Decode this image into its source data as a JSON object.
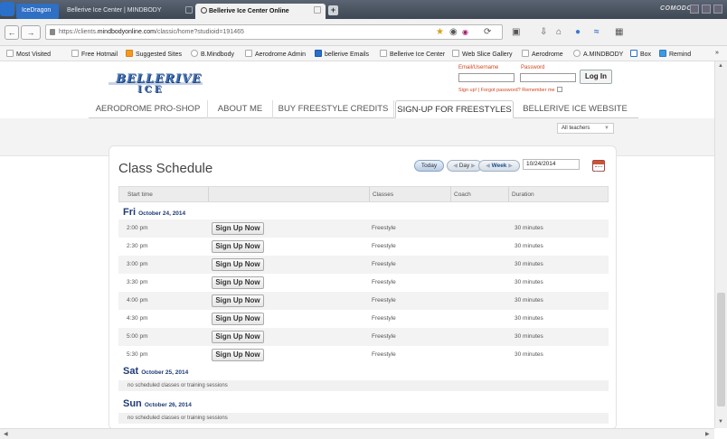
{
  "browser": {
    "brand": "COMODO",
    "tabs": [
      {
        "label": "IceDragon",
        "active": false
      },
      {
        "label": "Bellerive Ice Center | MINDBODY",
        "active": false
      },
      {
        "label": "Bellerive Ice Center Online",
        "active": true
      }
    ],
    "new_tab_label": "+",
    "url_prefix": "https://clients.",
    "url_domain": "mindbodyonline.com",
    "url_path": "/classic/home?studioid=191465"
  },
  "bookmarks": [
    "Most Visited",
    "Free Hotmail",
    "Suggested Sites",
    "B.Mindbody",
    "Aerodrome Admin",
    "bellerive Emails",
    "Bellerive Ice Center",
    "Web Slice Gallery",
    "Aerodrome",
    "A.MINDBODY",
    "Box",
    "Remind"
  ],
  "site": {
    "logo_line1": "BELLERIVE",
    "logo_line2": "ICE",
    "login": {
      "email_label": "Email/Username",
      "password_label": "Password",
      "button_label": "Log In",
      "signup_link": "Sign up!",
      "divider": "|",
      "forgot_link": "Forgot password?",
      "remember_label": "Remember me"
    },
    "menu": [
      "AERODROME PRO-SHOP",
      "ABOUT ME",
      "BUY FREESTYLE CREDITS",
      "SIGN-UP FOR FREESTYLES",
      "BELLERIVE ICE WEBSITE"
    ],
    "active_menu_index": 3,
    "teacher_filter": "All teachers"
  },
  "schedule": {
    "title": "Class Schedule",
    "today_label": "Today",
    "day_label": "Day",
    "week_label": "Week",
    "date_value": "10/24/2014",
    "columns": [
      "Start time",
      "",
      "Classes",
      "Coach",
      "Duration"
    ],
    "signup_label": "Sign Up Now",
    "days": [
      {
        "day": "Fri",
        "date": "October 24, 2014",
        "rows": [
          {
            "time": "2:00 pm",
            "class": "Freestyle",
            "coach": "",
            "duration": "30 minutes"
          },
          {
            "time": "2:30 pm",
            "class": "Freestyle",
            "coach": "",
            "duration": "30 minutes"
          },
          {
            "time": "3:00 pm",
            "class": "Freestyle",
            "coach": "",
            "duration": "30 minutes"
          },
          {
            "time": "3:30 pm",
            "class": "Freestyle",
            "coach": "",
            "duration": "30 minutes"
          },
          {
            "time": "4:00 pm",
            "class": "Freestyle",
            "coach": "",
            "duration": "30 minutes"
          },
          {
            "time": "4:30 pm",
            "class": "Freestyle",
            "coach": "",
            "duration": "30 minutes"
          },
          {
            "time": "5:00 pm",
            "class": "Freestyle",
            "coach": "",
            "duration": "30 minutes"
          },
          {
            "time": "5:30 pm",
            "class": "Freestyle",
            "coach": "",
            "duration": "30 minutes"
          }
        ]
      },
      {
        "day": "Sat",
        "date": "October 25, 2014",
        "empty": "no scheduled classes or training sessions"
      },
      {
        "day": "Sun",
        "date": "October 26, 2014",
        "empty": "no scheduled classes or training sessions"
      }
    ]
  }
}
